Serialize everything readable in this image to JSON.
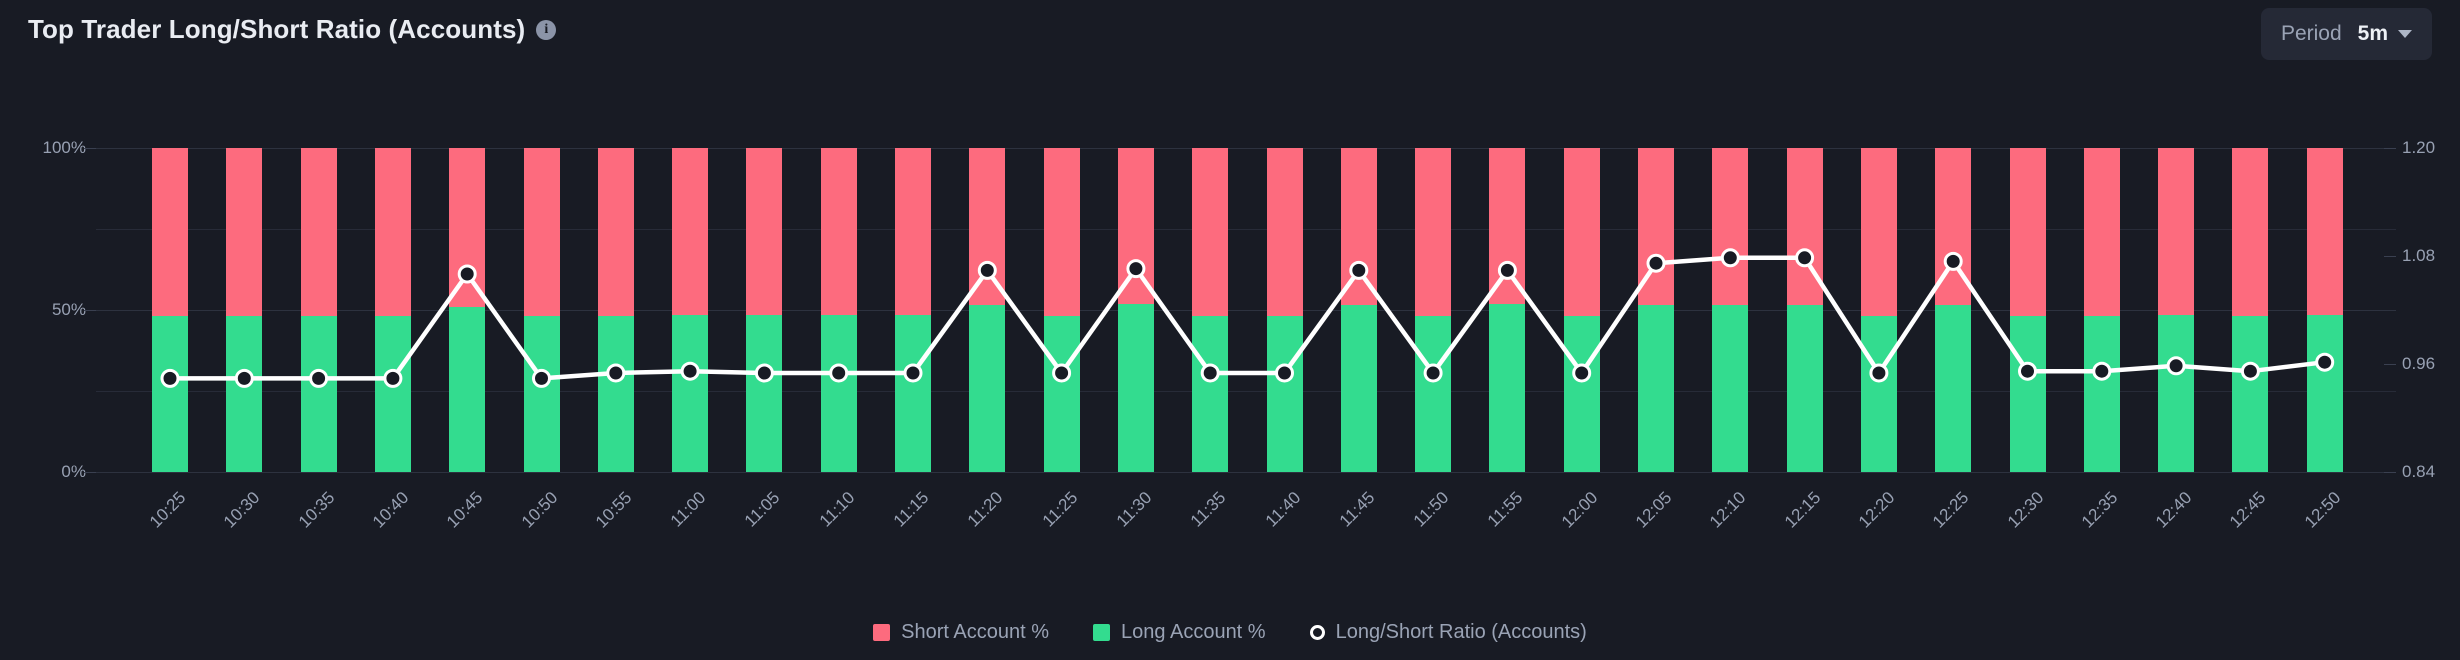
{
  "header": {
    "title": "Top Trader Long/Short Ratio (Accounts)",
    "info_icon": "info-icon",
    "period_label": "Period",
    "period_value": "5m",
    "caret_icon": "chevron-down-icon"
  },
  "colors": {
    "background": "#181b24",
    "short": "#fd6b7e",
    "long": "#33dc8f",
    "line": "#ffffff",
    "marker_fill": "#181b24",
    "axis_text": "#98a1b3",
    "grid": "#272b38",
    "panel_chip": "#252936"
  },
  "chart_data": {
    "type": "bar",
    "title": "Top Trader Long/Short Ratio (Accounts)",
    "xlabel": "",
    "ylabel": "",
    "grid": true,
    "legend_position": "bottom",
    "categories": [
      "10:25",
      "10:30",
      "10:35",
      "10:40",
      "10:45",
      "10:50",
      "10:55",
      "11:00",
      "11:05",
      "11:10",
      "11:15",
      "11:20",
      "11:25",
      "11:30",
      "11:35",
      "11:40",
      "11:45",
      "11:50",
      "11:55",
      "12:00",
      "12:05",
      "12:10",
      "12:15",
      "12:20",
      "12:25",
      "12:30",
      "12:35",
      "12:40",
      "12:45",
      "12:50"
    ],
    "left_axis": {
      "ticks": [
        "0%",
        "50%",
        "100%"
      ],
      "values": [
        0,
        50,
        100
      ],
      "ylim": [
        0,
        100
      ],
      "minor_ticks": [
        25,
        75
      ]
    },
    "right_axis": {
      "ticks": [
        "0.84",
        "0.96",
        "1.08",
        "1.20"
      ],
      "values": [
        0.84,
        0.96,
        1.08,
        1.2
      ],
      "ylim": [
        0.84,
        1.2
      ]
    },
    "series": [
      {
        "name": "Short Account %",
        "type": "bar",
        "axis": "left",
        "color": "#fd6b7e",
        "values": [
          52.0,
          52.0,
          52.0,
          52.0,
          49.0,
          52.0,
          52.0,
          51.6,
          51.6,
          51.6,
          51.6,
          48.5,
          51.9,
          48.3,
          51.8,
          51.8,
          48.4,
          51.9,
          48.3,
          51.8,
          48.5,
          48.4,
          48.4,
          51.9,
          48.4,
          51.8,
          51.8,
          51.6,
          51.8,
          51.6
        ]
      },
      {
        "name": "Long Account %",
        "type": "bar",
        "axis": "left",
        "color": "#33dc8f",
        "values": [
          48.0,
          48.0,
          48.0,
          48.0,
          51.0,
          48.0,
          48.0,
          48.4,
          48.4,
          48.4,
          48.4,
          51.5,
          48.1,
          51.7,
          48.2,
          48.2,
          51.6,
          48.1,
          51.7,
          48.2,
          51.5,
          51.6,
          51.6,
          48.1,
          51.6,
          48.2,
          48.2,
          48.4,
          48.2,
          48.4
        ]
      },
      {
        "name": "Long/Short Ratio (Accounts)",
        "type": "line",
        "axis": "right",
        "color": "#ffffff",
        "marker": "circle",
        "values": [
          0.944,
          0.944,
          0.944,
          0.944,
          1.06,
          0.944,
          0.95,
          0.952,
          0.95,
          0.95,
          0.95,
          1.064,
          0.95,
          1.066,
          0.95,
          0.95,
          1.064,
          0.95,
          1.064,
          0.95,
          1.072,
          1.078,
          1.078,
          0.95,
          1.074,
          0.952,
          0.952,
          0.958,
          0.952,
          0.962
        ]
      }
    ]
  },
  "legend": {
    "items": [
      {
        "label": "Short Account %",
        "marker": "square",
        "color": "#fd6b7e"
      },
      {
        "label": "Long Account %",
        "marker": "square",
        "color": "#33dc8f"
      },
      {
        "label": "Long/Short Ratio (Accounts)",
        "marker": "ring",
        "color": "#ffffff"
      }
    ]
  }
}
